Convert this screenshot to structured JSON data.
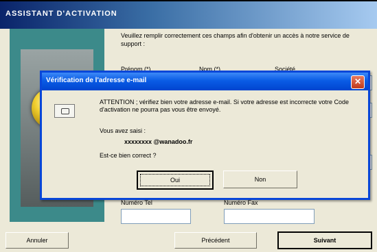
{
  "wizard": {
    "title": "ASSISTANT D'ACTIVATION",
    "intro": "Veuillez remplir correctement ces champs afin d'obtenir un accès à notre service de support :",
    "fields": {
      "col1_label": "Prénom (*)",
      "col2_label": "Nom (*)",
      "col3_label": "Société",
      "tel_label": "Numéro Tel",
      "fax_label": "Numéro Fax"
    },
    "buttons": {
      "cancel": "Annuler",
      "previous": "Précédent",
      "next": "Suivant"
    }
  },
  "dialog": {
    "title": "Vérification de l'adresse e-mail",
    "close_glyph": "✕",
    "warning": "ATTENTION ; vérifiez bien votre adresse e-mail. Si votre adresse est incorrecte votre Code d'activation ne pourra pas vous être envoyé.",
    "entered_label": "Vous avez saisi :",
    "email": "xxxxxxxx @wanadoo.fr",
    "question": "Est-ce bien correct ?",
    "buttons": {
      "yes": "Oui",
      "no": "Non"
    }
  }
}
